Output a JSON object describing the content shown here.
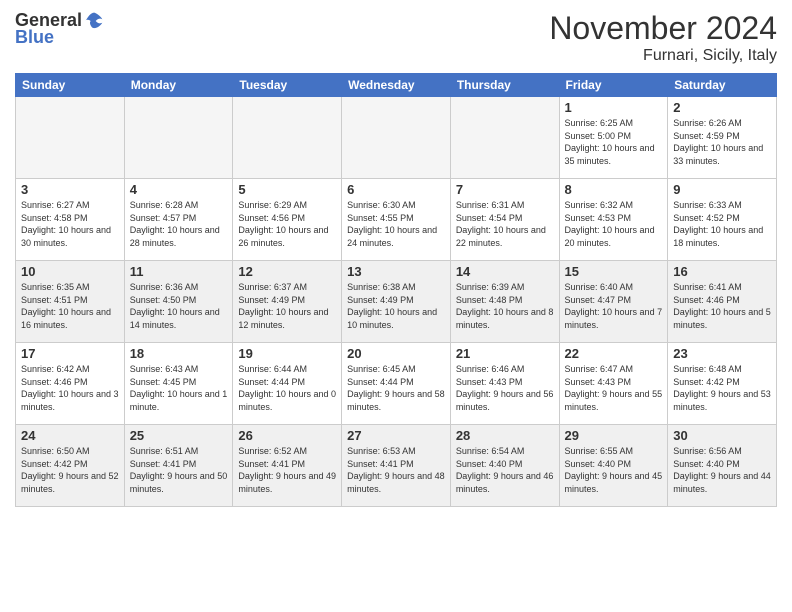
{
  "header": {
    "logo_general": "General",
    "logo_blue": "Blue",
    "month_title": "November 2024",
    "location": "Furnari, Sicily, Italy"
  },
  "days_of_week": [
    "Sunday",
    "Monday",
    "Tuesday",
    "Wednesday",
    "Thursday",
    "Friday",
    "Saturday"
  ],
  "weeks": [
    [
      {
        "day": "",
        "empty": true
      },
      {
        "day": "",
        "empty": true
      },
      {
        "day": "",
        "empty": true
      },
      {
        "day": "",
        "empty": true
      },
      {
        "day": "",
        "empty": true
      },
      {
        "day": "1",
        "sunrise": "Sunrise: 6:25 AM",
        "sunset": "Sunset: 5:00 PM",
        "daylight": "Daylight: 10 hours and 35 minutes."
      },
      {
        "day": "2",
        "sunrise": "Sunrise: 6:26 AM",
        "sunset": "Sunset: 4:59 PM",
        "daylight": "Daylight: 10 hours and 33 minutes."
      }
    ],
    [
      {
        "day": "3",
        "sunrise": "Sunrise: 6:27 AM",
        "sunset": "Sunset: 4:58 PM",
        "daylight": "Daylight: 10 hours and 30 minutes."
      },
      {
        "day": "4",
        "sunrise": "Sunrise: 6:28 AM",
        "sunset": "Sunset: 4:57 PM",
        "daylight": "Daylight: 10 hours and 28 minutes."
      },
      {
        "day": "5",
        "sunrise": "Sunrise: 6:29 AM",
        "sunset": "Sunset: 4:56 PM",
        "daylight": "Daylight: 10 hours and 26 minutes."
      },
      {
        "day": "6",
        "sunrise": "Sunrise: 6:30 AM",
        "sunset": "Sunset: 4:55 PM",
        "daylight": "Daylight: 10 hours and 24 minutes."
      },
      {
        "day": "7",
        "sunrise": "Sunrise: 6:31 AM",
        "sunset": "Sunset: 4:54 PM",
        "daylight": "Daylight: 10 hours and 22 minutes."
      },
      {
        "day": "8",
        "sunrise": "Sunrise: 6:32 AM",
        "sunset": "Sunset: 4:53 PM",
        "daylight": "Daylight: 10 hours and 20 minutes."
      },
      {
        "day": "9",
        "sunrise": "Sunrise: 6:33 AM",
        "sunset": "Sunset: 4:52 PM",
        "daylight": "Daylight: 10 hours and 18 minutes."
      }
    ],
    [
      {
        "day": "10",
        "sunrise": "Sunrise: 6:35 AM",
        "sunset": "Sunset: 4:51 PM",
        "daylight": "Daylight: 10 hours and 16 minutes."
      },
      {
        "day": "11",
        "sunrise": "Sunrise: 6:36 AM",
        "sunset": "Sunset: 4:50 PM",
        "daylight": "Daylight: 10 hours and 14 minutes."
      },
      {
        "day": "12",
        "sunrise": "Sunrise: 6:37 AM",
        "sunset": "Sunset: 4:49 PM",
        "daylight": "Daylight: 10 hours and 12 minutes."
      },
      {
        "day": "13",
        "sunrise": "Sunrise: 6:38 AM",
        "sunset": "Sunset: 4:49 PM",
        "daylight": "Daylight: 10 hours and 10 minutes."
      },
      {
        "day": "14",
        "sunrise": "Sunrise: 6:39 AM",
        "sunset": "Sunset: 4:48 PM",
        "daylight": "Daylight: 10 hours and 8 minutes."
      },
      {
        "day": "15",
        "sunrise": "Sunrise: 6:40 AM",
        "sunset": "Sunset: 4:47 PM",
        "daylight": "Daylight: 10 hours and 7 minutes."
      },
      {
        "day": "16",
        "sunrise": "Sunrise: 6:41 AM",
        "sunset": "Sunset: 4:46 PM",
        "daylight": "Daylight: 10 hours and 5 minutes."
      }
    ],
    [
      {
        "day": "17",
        "sunrise": "Sunrise: 6:42 AM",
        "sunset": "Sunset: 4:46 PM",
        "daylight": "Daylight: 10 hours and 3 minutes."
      },
      {
        "day": "18",
        "sunrise": "Sunrise: 6:43 AM",
        "sunset": "Sunset: 4:45 PM",
        "daylight": "Daylight: 10 hours and 1 minute."
      },
      {
        "day": "19",
        "sunrise": "Sunrise: 6:44 AM",
        "sunset": "Sunset: 4:44 PM",
        "daylight": "Daylight: 10 hours and 0 minutes."
      },
      {
        "day": "20",
        "sunrise": "Sunrise: 6:45 AM",
        "sunset": "Sunset: 4:44 PM",
        "daylight": "Daylight: 9 hours and 58 minutes."
      },
      {
        "day": "21",
        "sunrise": "Sunrise: 6:46 AM",
        "sunset": "Sunset: 4:43 PM",
        "daylight": "Daylight: 9 hours and 56 minutes."
      },
      {
        "day": "22",
        "sunrise": "Sunrise: 6:47 AM",
        "sunset": "Sunset: 4:43 PM",
        "daylight": "Daylight: 9 hours and 55 minutes."
      },
      {
        "day": "23",
        "sunrise": "Sunrise: 6:48 AM",
        "sunset": "Sunset: 4:42 PM",
        "daylight": "Daylight: 9 hours and 53 minutes."
      }
    ],
    [
      {
        "day": "24",
        "sunrise": "Sunrise: 6:50 AM",
        "sunset": "Sunset: 4:42 PM",
        "daylight": "Daylight: 9 hours and 52 minutes."
      },
      {
        "day": "25",
        "sunrise": "Sunrise: 6:51 AM",
        "sunset": "Sunset: 4:41 PM",
        "daylight": "Daylight: 9 hours and 50 minutes."
      },
      {
        "day": "26",
        "sunrise": "Sunrise: 6:52 AM",
        "sunset": "Sunset: 4:41 PM",
        "daylight": "Daylight: 9 hours and 49 minutes."
      },
      {
        "day": "27",
        "sunrise": "Sunrise: 6:53 AM",
        "sunset": "Sunset: 4:41 PM",
        "daylight": "Daylight: 9 hours and 48 minutes."
      },
      {
        "day": "28",
        "sunrise": "Sunrise: 6:54 AM",
        "sunset": "Sunset: 4:40 PM",
        "daylight": "Daylight: 9 hours and 46 minutes."
      },
      {
        "day": "29",
        "sunrise": "Sunrise: 6:55 AM",
        "sunset": "Sunset: 4:40 PM",
        "daylight": "Daylight: 9 hours and 45 minutes."
      },
      {
        "day": "30",
        "sunrise": "Sunrise: 6:56 AM",
        "sunset": "Sunset: 4:40 PM",
        "daylight": "Daylight: 9 hours and 44 minutes."
      }
    ]
  ]
}
